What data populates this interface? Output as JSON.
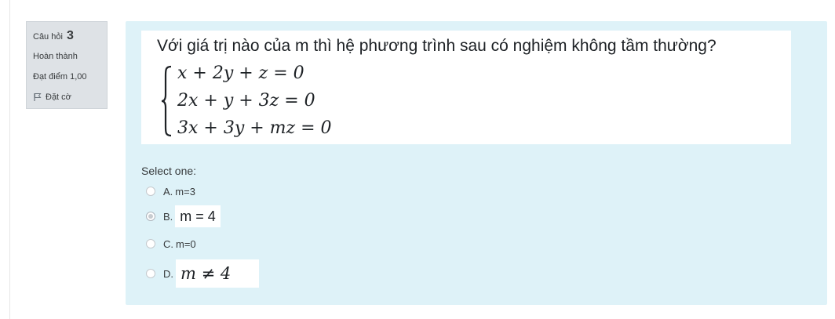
{
  "info": {
    "question_label": "Câu hỏi",
    "question_number": "3",
    "status": "Hoàn thành",
    "grade": "Đạt điểm 1,00",
    "flag_label": "Đặt cờ"
  },
  "question": {
    "title": "Với giá trị nào của m thì hệ phương trình sau có nghiệm không tầm thường?",
    "equations": [
      "x + 2y + z = 0",
      "2x + y + 3z = 0",
      "3x + 3y + mz = 0"
    ]
  },
  "answer": {
    "prompt": "Select one:",
    "options": [
      {
        "letter": "A.",
        "text": "m=3",
        "selected": false
      },
      {
        "letter": "B.",
        "text": "m = 4",
        "selected": true
      },
      {
        "letter": "C.",
        "text": "m=0",
        "selected": false
      },
      {
        "letter": "D.",
        "text": "m ≠ 4",
        "selected": false
      }
    ]
  },
  "colors": {
    "content_bg": "#def2f8",
    "info_bg": "#dee2e6",
    "text": "#373a3c"
  }
}
